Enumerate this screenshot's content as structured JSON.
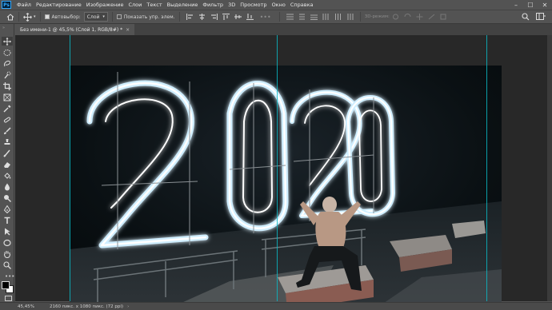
{
  "app": {
    "logo_text": "Ps"
  },
  "menu": {
    "items": [
      "Файл",
      "Редактирование",
      "Изображение",
      "Слои",
      "Текст",
      "Выделение",
      "Фильтр",
      "3D",
      "Просмотр",
      "Окно",
      "Справка"
    ]
  },
  "window_controls": {
    "minimize": "–",
    "maximize": "☐",
    "close": "✕"
  },
  "options_bar": {
    "autoselect_label": "Автовыбор:",
    "autoselect_checked": true,
    "autoselect_target": "Слой",
    "show_transform_label": "Показать упр. элем.",
    "show_transform_checked": false,
    "mode_3d_label": "3D-режим:"
  },
  "document_tab": {
    "title": "Без имени-1 @ 45,5% (Слой 1, RGB/8#) *",
    "close": "×"
  },
  "status_bar": {
    "zoom": "45,45%",
    "doc_info": "2160 пикс. x 1080 пикс. (72 ppi)",
    "arrow": "›"
  },
  "artboard_image": {
    "year_text": "2020",
    "colors": {
      "neon": "#ffffff",
      "glow": "#bfe9ff",
      "background": "#0a0f12",
      "guides": "#0bb7c3"
    }
  },
  "toolbar": {
    "tools": [
      "move-tool",
      "marquee-tool",
      "lasso-tool",
      "quick-select-tool",
      "crop-tool",
      "frame-tool",
      "eyedropper-tool",
      "spot-healing-tool",
      "brush-tool",
      "clone-stamp-tool",
      "history-brush-tool",
      "eraser-tool",
      "gradient-tool",
      "blur-tool",
      "dodge-tool",
      "pen-tool",
      "type-tool",
      "path-select-tool",
      "rectangle-tool",
      "hand-tool",
      "zoom-tool"
    ]
  }
}
